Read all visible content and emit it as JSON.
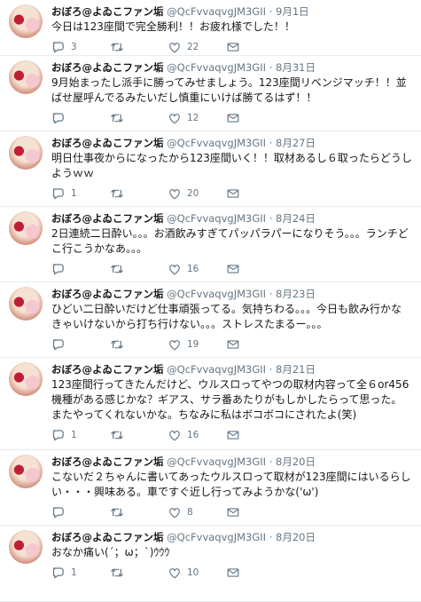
{
  "tweets": [
    {
      "name": "おぼろ@よゐこファン垢",
      "handle": "@QcFvvaqvgJM3GII",
      "date": "9月1日",
      "text": "今日は123座間で完全勝利！！お疲れ様でした！！",
      "replies": "3",
      "retweets": "",
      "likes": "22"
    },
    {
      "name": "おぼろ@よゐこファン垢",
      "handle": "@QcFvvaqvgJM3GII",
      "date": "8月31日",
      "text": "9月始まったし派手に勝ってみせましょう。123座間リベンジマッチ！！並ばせ屋呼んでるみたいだし慎重にいけば勝てるはず！！",
      "replies": "",
      "retweets": "",
      "likes": "12"
    },
    {
      "name": "おぼろ@よゐこファン垢",
      "handle": "@QcFvvaqvgJM3GII",
      "date": "8月27日",
      "text": "明日仕事夜からになったから123座間いく！！取材あるし６取ったらどうしようｗｗ",
      "replies": "1",
      "retweets": "",
      "likes": "20"
    },
    {
      "name": "おぼろ@よゐこファン垢",
      "handle": "@QcFvvaqvgJM3GII",
      "date": "8月24日",
      "text": "2日連続二日酔い。。。お酒飲みすぎてパッパラパーになりそう。。。ランチどこ行こうかなあ。。。",
      "replies": "",
      "retweets": "",
      "likes": "16"
    },
    {
      "name": "おぼろ@よゐこファン垢",
      "handle": "@QcFvvaqvgJM3GII",
      "date": "8月23日",
      "text": "ひどい二日酔いだけど仕事頑張ってる。気持ちわる。。。今日も飲み行かなきゃいけないから打ち行けない。。。ストレスたまるー。。。",
      "replies": "",
      "retweets": "",
      "likes": "19"
    },
    {
      "name": "おぼろ@よゐこファン垢",
      "handle": "@QcFvvaqvgJM3GII",
      "date": "8月21日",
      "text": "123座間行ってきたんだけど、ウルスロってやつの取材内容って全６or456機種がある感じかな？ギアス、サラ番あたりがもしかしたらって思った。またやってくれないかな。ちなみに私はボコボコにされたよ(笑)",
      "replies": "1",
      "retweets": "",
      "likes": "16"
    },
    {
      "name": "おぼろ@よゐこファン垢",
      "handle": "@QcFvvaqvgJM3GII",
      "date": "8月20日",
      "text": "こないだ２ちゃんに書いてあったウルスロって取材が123座間にはいるらしい・・・興味ある。車ですぐ近し行ってみようかな('ω')",
      "replies": "",
      "retweets": "",
      "likes": "8"
    },
    {
      "name": "おぼろ@よゐこファン垢",
      "handle": "@QcFvvaqvgJM3GII",
      "date": "8月20日",
      "text": "おなか痛い(´；ω；`)ｳｳｳ",
      "replies": "1",
      "retweets": "",
      "likes": "10"
    }
  ],
  "separator": "·"
}
